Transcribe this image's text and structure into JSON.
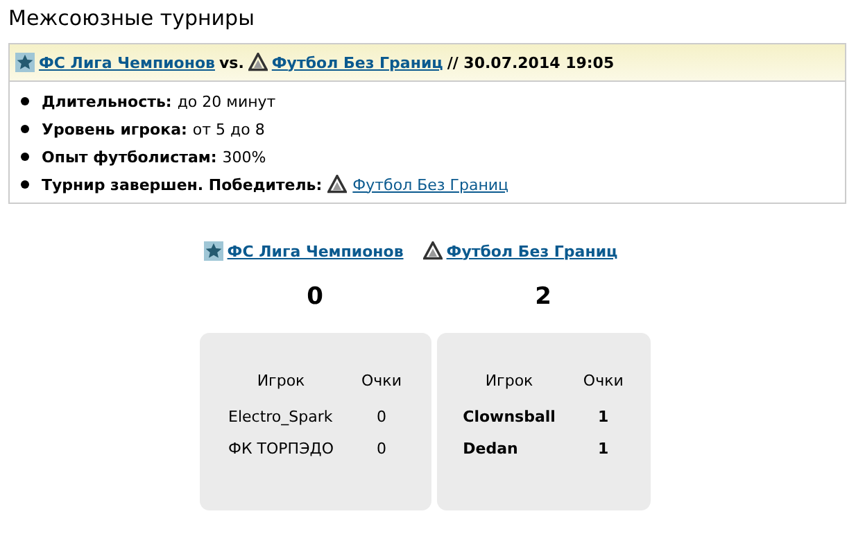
{
  "page_title": "Межсоюзные турниры",
  "match": {
    "home": {
      "name": "ФС Лига Чемпионов",
      "kind": "star"
    },
    "vs": "vs.",
    "away": {
      "name": "Футбол Без Границ",
      "kind": "triangle"
    },
    "datetime": "// 30.07.2014 19:05"
  },
  "details": [
    {
      "label": "Длительность:",
      "value": "до 20 минут"
    },
    {
      "label": "Уровень игрока:",
      "value": "от 5 до 8"
    },
    {
      "label": "Опыт футболистам:",
      "value": "300%"
    },
    {
      "label": "Турнир завершен. Победитель:",
      "winner": {
        "name": "Футбол Без Границ",
        "kind": "triangle"
      }
    }
  ],
  "teams": [
    {
      "name": "ФС Лига Чемпионов",
      "kind": "star",
      "score": "0",
      "winner": false,
      "columns": [
        "Игрок",
        "Очки"
      ],
      "rows": [
        [
          "Electro_Spark",
          "0"
        ],
        [
          "ФК ТОРПЭДО",
          "0"
        ]
      ]
    },
    {
      "name": "Футбол Без Границ",
      "kind": "triangle",
      "score": "2",
      "winner": true,
      "columns": [
        "Игрок",
        "Очки"
      ],
      "rows": [
        [
          "Clownsball",
          "1"
        ],
        [
          "Dedan",
          "1"
        ]
      ]
    }
  ]
}
